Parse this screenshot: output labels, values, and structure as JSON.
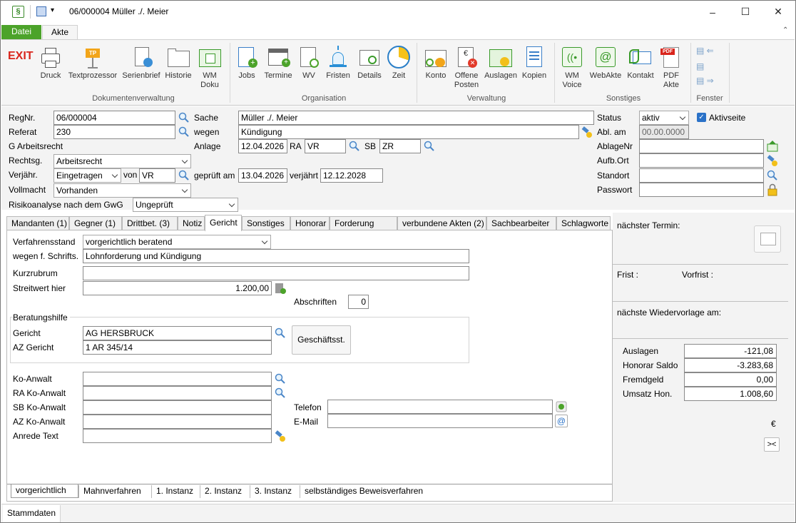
{
  "title_bar": {
    "title": "06/000004 Müller ./. Meier",
    "minimize": "–",
    "maximize": "☐",
    "close": "✕"
  },
  "ribbon_tabs": [
    "Datei",
    "Akte"
  ],
  "ribbon": {
    "exit": "EXIT",
    "dokumente": {
      "group": "Dokumentenverwaltung",
      "items": [
        "Druck",
        "Textprozessor",
        "Serienbrief",
        "Historie",
        "WM Doku"
      ]
    },
    "organisation": {
      "group": "Organisation",
      "items": [
        "Jobs",
        "Termine",
        "WV",
        "Fristen",
        "Details",
        "Zeit"
      ]
    },
    "verwaltung": {
      "group": "Verwaltung",
      "items": [
        "Konto",
        "Offene Posten",
        "Auslagen",
        "Kopien"
      ]
    },
    "sonstiges": {
      "group": "Sonstiges",
      "items": [
        "WM Voice",
        "WebAkte",
        "Kontakt",
        "PDF Akte"
      ]
    },
    "fenster": {
      "group": "Fenster"
    }
  },
  "form": {
    "regnr_label": "RegNr.",
    "regnr": "06/000004",
    "referat_label": "Referat",
    "referat": "230",
    "g_arbeitsrecht": "G Arbeitsrecht",
    "rechtsg_label": "Rechtsg.",
    "rechtsg": "Arbeitsrecht",
    "verjaehr_label": "Verjähr.",
    "verjaehr": "Eingetragen",
    "von_label": "von",
    "von": "VR",
    "vollmacht_label": "Vollmacht",
    "vollmacht": "Vorhanden",
    "risiko_label": "Risikoanalyse nach dem GwG",
    "risiko": "Ungeprüft",
    "sache_label": "Sache",
    "sache": "Müller ./. Meier",
    "wegen_label": "wegen",
    "wegen": "Kündigung",
    "anlage_label": "Anlage",
    "anlage": "12.04.2026",
    "ra_label": "RA",
    "ra": "VR",
    "sb_label": "SB",
    "sb": "ZR",
    "geprueft_label": "geprüft am",
    "geprueft": "13.04.2026",
    "verjaehrt_label": "verjährt",
    "verjaehrt": "12.12.2028",
    "status_label": "Status",
    "status": "aktiv",
    "aktivseite": "Aktivseite",
    "abl_label": "Abl. am",
    "abl": "00.00.0000",
    "ablagenr_label": "AblageNr",
    "aufb_label": "Aufb.Ort",
    "standort_label": "Standort",
    "passwort_label": "Passwort"
  },
  "tabs": [
    "Mandanten (1)",
    "Gegner (1)",
    "Drittbet. (3)",
    "Notiz",
    "Gericht",
    "Sonstiges",
    "Honorar",
    "Forderung",
    "verbundene Akten (2)",
    "Sachbearbeiter",
    "Schlagworte"
  ],
  "gericht": {
    "verfahrensstand_label": "Verfahrensstand",
    "verfahrensstand": "vorgerichtlich beratend",
    "wegen_label": "wegen f. Schrifts.",
    "wegen": "Lohnforderung und Kündigung",
    "kurzrubrum_label": "Kurzrubrum",
    "kurzrubrum": "",
    "streitwert_label": "Streitwert hier",
    "streitwert": "1.200,00",
    "abschriften_label": "Abschriften",
    "abschriften": "0",
    "beratungshilfe": "Beratungshilfe",
    "gericht_label": "Gericht",
    "gericht": "AG HERSBRUCK",
    "az_label": "AZ Gericht",
    "az": "1 AR 345/14",
    "geschaeftsst": "Geschäftsst.",
    "ko_anwalt": "Ko-Anwalt",
    "ra_ko": "RA Ko-Anwalt",
    "sb_ko": "SB Ko-Anwalt",
    "az_ko": "AZ Ko-Anwalt",
    "anrede": "Anrede Text",
    "telefon": "Telefon",
    "email": "E-Mail"
  },
  "right": {
    "naechster_termin": "nächster Termin:",
    "frist": "Frist :",
    "vorfrist": "Vorfrist :",
    "wiedervorlage": "nächste Wiedervorlage am:",
    "auslagen_label": "Auslagen",
    "auslagen": "-121,08",
    "honorar_label": "Honorar Saldo",
    "honorar": "-3.283,68",
    "fremdgeld_label": "Fremdgeld",
    "fremdgeld": "0,00",
    "umsatz_label": "Umsatz Hon.",
    "umsatz": "1.008,60",
    "currency": "€",
    "swap": "><"
  },
  "bottom_tabs": [
    "vorgerichtlich",
    "Mahnverfahren",
    "1. Instanz",
    "2. Instanz",
    "3. Instanz",
    "selbständiges Beweisverfahren"
  ],
  "status_bar": "Stammdaten"
}
